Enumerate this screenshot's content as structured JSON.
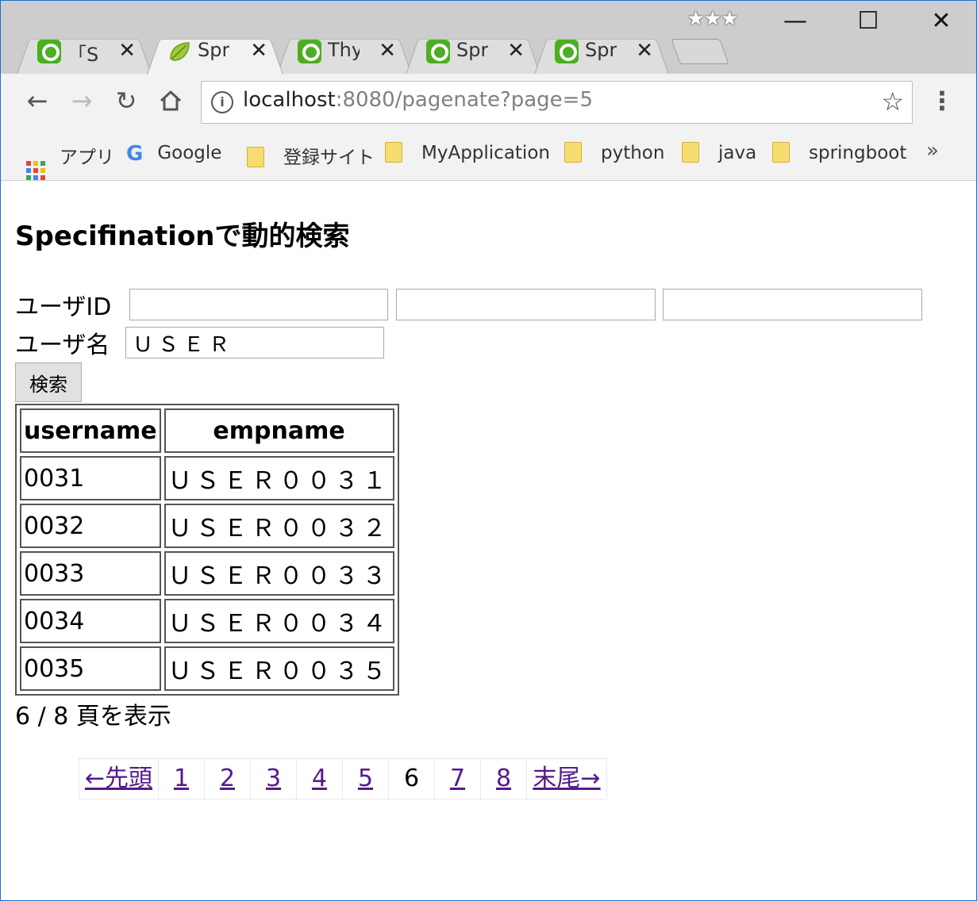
{
  "browser": {
    "tabs": [
      {
        "title": "「Spr",
        "favicon": "qiita-icon"
      },
      {
        "title": "Sprin",
        "favicon": "spring-leaf-icon"
      },
      {
        "title": "Thym",
        "favicon": "qiita-icon"
      },
      {
        "title": "Sprin",
        "favicon": "qiita-icon"
      },
      {
        "title": "Sprin",
        "favicon": "qiita-icon"
      }
    ],
    "active_tab": 1,
    "profile_badge": "★★★",
    "url_host": "localhost",
    "url_rest": ":8080/pagenate?page=5",
    "bookmarks": [
      {
        "label": "アプリ",
        "icon": "apps-grid-icon"
      },
      {
        "label": "Google",
        "icon": "google-icon"
      },
      {
        "label": "登録サイト",
        "icon": "folder-icon"
      },
      {
        "label": "MyApplication",
        "icon": "folder-icon"
      },
      {
        "label": "python",
        "icon": "folder-icon"
      },
      {
        "label": "java",
        "icon": "folder-icon"
      },
      {
        "label": "springboot",
        "icon": "folder-icon"
      }
    ],
    "bookmarks_more": "»"
  },
  "page": {
    "heading": "Specifinationで動的検索",
    "form": {
      "userid_label": "ユーザID",
      "userid_values": [
        "",
        "",
        ""
      ],
      "username_label": "ユーザ名",
      "username_value": "ＵＳＥＲ",
      "search_button": "検索"
    },
    "table": {
      "headers": [
        "username",
        "empname"
      ],
      "rows": [
        [
          "0031",
          "ＵＳＥＲ００３１"
        ],
        [
          "0032",
          "ＵＳＥＲ００３２"
        ],
        [
          "0033",
          "ＵＳＥＲ００３３"
        ],
        [
          "0034",
          "ＵＳＥＲ００３４"
        ],
        [
          "0035",
          "ＵＳＥＲ００３５"
        ]
      ]
    },
    "page_info": "6 / 8 頁を表示",
    "pager": {
      "first": "←先頭",
      "pages": [
        "1",
        "2",
        "3",
        "4",
        "5",
        "6",
        "7",
        "8"
      ],
      "current": "6",
      "last": "末尾→"
    }
  }
}
